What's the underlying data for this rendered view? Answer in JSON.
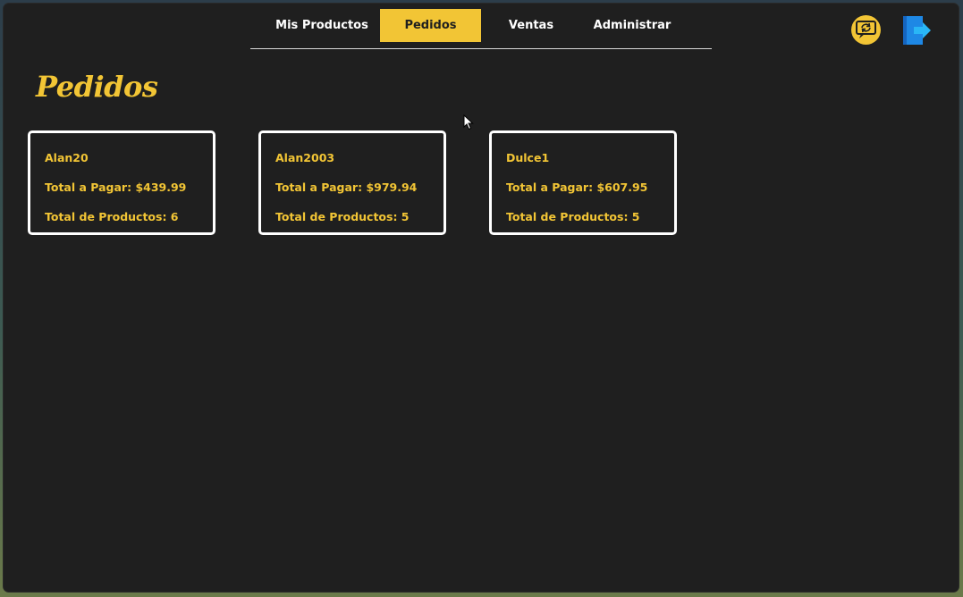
{
  "nav": {
    "tabs": [
      {
        "label": "Mis Productos",
        "active": false
      },
      {
        "label": "Pedidos",
        "active": true
      },
      {
        "label": "Ventas",
        "active": false
      },
      {
        "label": "Administrar",
        "active": false
      }
    ]
  },
  "header": {
    "refresh_icon": "refresh-icon",
    "logout_icon": "logout-icon"
  },
  "page": {
    "title": "Pedidos"
  },
  "orders": [
    {
      "user": "Alan20",
      "total": "Total a Pagar: $439.99",
      "products": "Total de Productos: 6"
    },
    {
      "user": "Alan2003",
      "total": "Total a Pagar: $979.94",
      "products": "Total de Productos: 5"
    },
    {
      "user": "Dulce1",
      "total": "Total a Pagar: $607.95",
      "products": "Total de Productos: 5"
    }
  ],
  "colors": {
    "accent": "#f2c535",
    "background": "#1f1f1f",
    "logout": "#1e88e5"
  }
}
